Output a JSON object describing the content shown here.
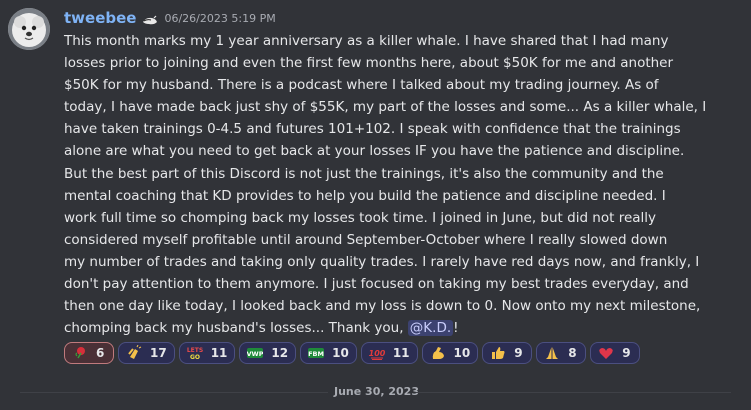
{
  "message": {
    "username": "tweebee",
    "timestamp": "06/26/2023 5:19 PM",
    "lines": [
      "This month marks my 1 year anniversary as a killer whale.  I have shared that I had many",
      "losses prior to joining and even the first few months here, about $50K for me and another",
      "$50K for my husband. There is a podcast where I talked about my trading journey.  As of",
      "today, I have made back just shy of $55K, my part of the losses and some... As a killer whale, I",
      "have taken trainings 0-4.5 and futures 101+102.  I speak with confidence that the trainings",
      "alone are what you need to get back at your losses IF you have the patience and discipline.",
      "But the best part of this Discord is not just the trainings, it's also the community and the",
      "mental coaching that KD provides to help you build the patience and discipline needed.  I",
      "work full time so chomping back my losses took time.  I joined in June, but did not really",
      "considered myself profitable until around September-October where I really slowed down",
      "my number of trades and taking only quality trades.  I rarely have red days now, and frankly, I",
      "don't pay attention to them anymore.  I just focused on taking my best trades everyday, and",
      "then one day like today, I looked back and my loss is down to 0.  Now onto my next milestone,"
    ],
    "last_line_prefix": "chomping back my husband's losses... Thank you, ",
    "mention": "@K.D.",
    "last_line_suffix": "!"
  },
  "reactions": [
    {
      "icon": "rose-icon",
      "glyph": "🌹",
      "count": "6",
      "active": true
    },
    {
      "icon": "clap-icon",
      "glyph": "👏",
      "count": "17",
      "active": false
    },
    {
      "icon": "lets-go-icon",
      "glyph": "LETS GO",
      "count": "11",
      "active": false
    },
    {
      "icon": "vwp-icon",
      "glyph": "VWP",
      "count": "12",
      "active": false
    },
    {
      "icon": "fbm-icon",
      "glyph": "FBM",
      "count": "10",
      "active": false
    },
    {
      "icon": "hundred-icon",
      "glyph": "💯",
      "count": "11",
      "active": false
    },
    {
      "icon": "flexed-bicep-icon",
      "glyph": "💪",
      "count": "10",
      "active": false
    },
    {
      "icon": "thumbs-up-icon",
      "glyph": "👍",
      "count": "9",
      "active": false
    },
    {
      "icon": "pray-icon",
      "glyph": "🙏",
      "count": "8",
      "active": false
    },
    {
      "icon": "heart-icon",
      "glyph": "❤",
      "count": "9",
      "active": false
    }
  ],
  "date_divider": "June 30, 2023",
  "colors": {
    "background": "#313338",
    "username": "#7fb3f5",
    "reaction_bg": "#2b2d52",
    "reaction_border": "#4b4f80",
    "mention_bg": "#3c4270"
  }
}
